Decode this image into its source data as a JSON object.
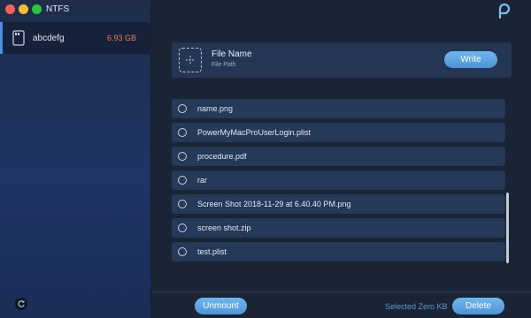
{
  "window": {
    "title": "NTFS"
  },
  "sidebar": {
    "drives": [
      {
        "name": "abcdefg",
        "size": "6.93 GB"
      }
    ],
    "refresh_icon": "refresh-icon"
  },
  "write_panel": {
    "file_name": "File Name",
    "file_path": "File Path",
    "write_label": "Write",
    "placeholder_icon": "dashed-file-placeholder-icon"
  },
  "files": [
    {
      "name": "name.png"
    },
    {
      "name": "PowerMyMacProUserLogin.plist"
    },
    {
      "name": "procedure.pdf"
    },
    {
      "name": "rar"
    },
    {
      "name": "Screen Shot 2018-11-29 at 6.40.40 PM.png"
    },
    {
      "name": "screen shot.zip"
    },
    {
      "name": "test.plist"
    }
  ],
  "footer": {
    "unmount_label": "Unmount",
    "selected_text": "Selected Zero KB",
    "delete_label": "Delete"
  },
  "colors": {
    "accent": "#5aa3e3",
    "size_text": "#f27a52",
    "selected_text": "#5f95da"
  }
}
